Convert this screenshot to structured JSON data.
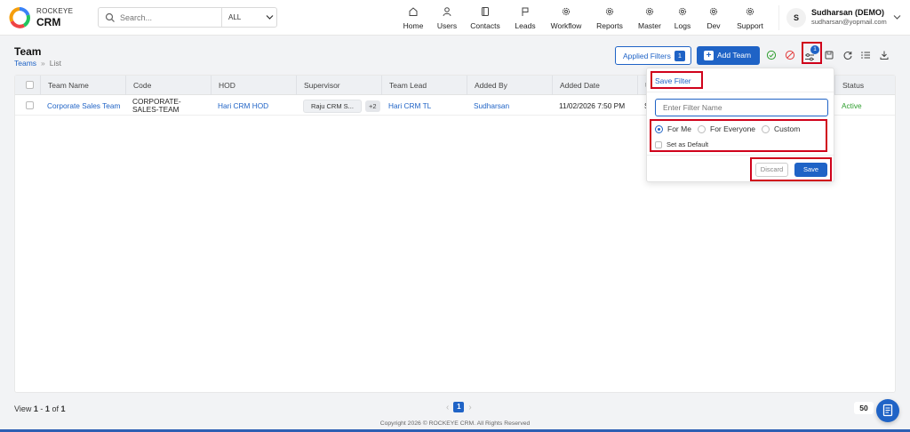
{
  "app": {
    "brand_top": "ROCKEYE",
    "brand_bottom": "CRM"
  },
  "search": {
    "placeholder": "Search...",
    "scope": "ALL"
  },
  "nav": [
    {
      "label": "Home",
      "icon": "home-icon"
    },
    {
      "label": "Users",
      "icon": "user-icon"
    },
    {
      "label": "Contacts",
      "icon": "contacts-icon"
    },
    {
      "label": "Leads",
      "icon": "flag-icon"
    },
    {
      "label": "Workflow",
      "icon": "gear-icon"
    },
    {
      "label": "Reports",
      "icon": "gear-icon"
    },
    {
      "label": "Master",
      "icon": "gear-icon"
    },
    {
      "label": "Logs",
      "icon": "gear-icon"
    },
    {
      "label": "Dev",
      "icon": "gear-icon"
    },
    {
      "label": "Support",
      "icon": "gear-icon"
    }
  ],
  "user": {
    "initial": "S",
    "name": "Sudharsan (DEMO)",
    "email": "sudharsan@yopmail.com"
  },
  "page": {
    "title": "Team",
    "breadcrumb": [
      "Teams",
      "List"
    ]
  },
  "toolbar": {
    "applied_filters_label": "Applied Filters",
    "applied_filters_count": "1",
    "add_label": "Add Team",
    "filter_badge": "1"
  },
  "table": {
    "columns": [
      "Team Name",
      "Code",
      "HOD",
      "Supervisor",
      "Team Lead",
      "Added By",
      "Added Date",
      "U",
      "Status"
    ],
    "rows": [
      {
        "team_name": "Corporate Sales Team",
        "code": "CORPORATE-SALES-TEAM",
        "hod": "Hari CRM HOD",
        "supervisor": "Raju CRM S...",
        "supervisor_more": "+2",
        "team_lead": "Hari CRM TL",
        "added_by": "Sudharsan",
        "added_date": "11/02/2026 7:50 PM",
        "updated": "S",
        "status": "Active"
      }
    ]
  },
  "popup": {
    "title": "Save Filter",
    "name_placeholder": "Enter Filter Name",
    "options": [
      {
        "label": "For Me",
        "selected": true
      },
      {
        "label": "For Everyone",
        "selected": false
      },
      {
        "label": "Custom",
        "selected": false
      }
    ],
    "default_label": "Set as Default",
    "discard_label": "Discard",
    "save_label": "Save"
  },
  "footer": {
    "view_prefix": "View",
    "range_start": "1",
    "range_sep": "-",
    "range_end": "1",
    "of_label": "of",
    "total": "1",
    "current_page": "1",
    "page_size": "50",
    "copyright": "Copyright 2026 © ROCKEYE CRM. All Rights Reserved"
  },
  "colors": {
    "primary": "#1f63c6",
    "active": "#2e9e2e",
    "highlight": "#d0021b"
  }
}
